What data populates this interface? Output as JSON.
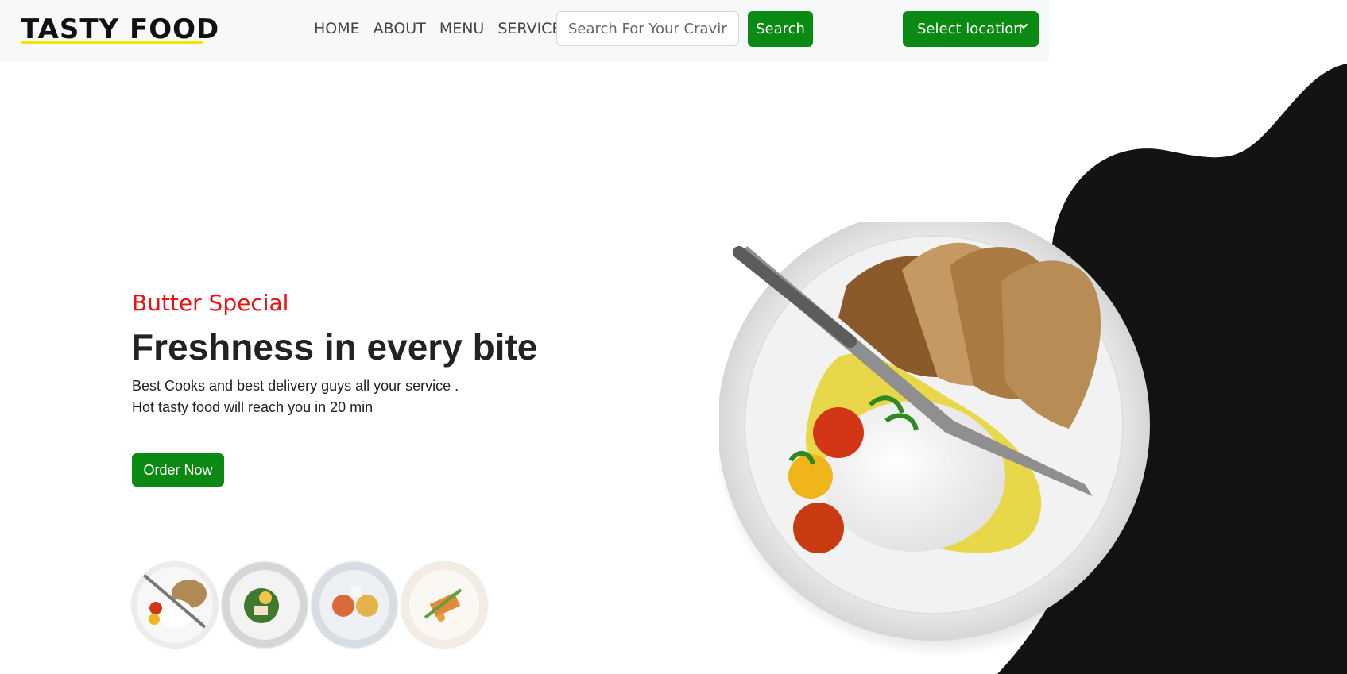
{
  "brand": {
    "name": "TASTY FOOD"
  },
  "nav": {
    "links": [
      "HOME",
      "ABOUT",
      "MENU",
      "SERVICES"
    ]
  },
  "search": {
    "placeholder": "Search For Your Craving",
    "button_label": "Search"
  },
  "location": {
    "label": "Select location"
  },
  "hero": {
    "eyebrow": "Butter Special",
    "headline": "Freshness in every bite",
    "description_lines": [
      "Best Cooks and best delivery guys all your service .",
      "Hot tasty food will reach you in 20 min"
    ],
    "order_button": "Order Now"
  },
  "icons": {
    "chevron": "chevron-down-icon",
    "main_image": "plate-image",
    "thumbnails": [
      "dish-thumb-1",
      "dish-thumb-2",
      "dish-thumb-3",
      "dish-thumb-4"
    ]
  },
  "colors": {
    "accent_green": "#0a8a12",
    "eyebrow_red": "#ee1111",
    "brand_underline": "#f3e600",
    "blob": "#131313"
  }
}
